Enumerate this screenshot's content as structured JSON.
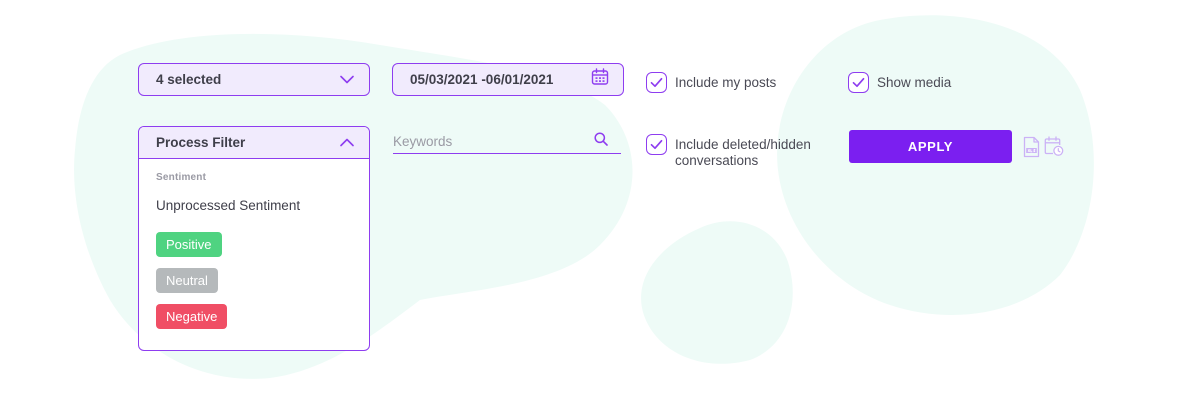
{
  "filters": {
    "selection_summary": "4 selected",
    "date_range": "05/03/2021 -06/01/2021",
    "keywords_placeholder": "Keywords",
    "keywords_value": ""
  },
  "process_filter": {
    "title": "Process Filter",
    "section_label": "Sentiment",
    "option_unprocessed": "Unprocessed Sentiment",
    "chips": [
      {
        "label": "Positive",
        "color": "#4fd381"
      },
      {
        "label": "Neutral",
        "color": "#b5b9bb"
      },
      {
        "label": "Negative",
        "color": "#f04e65"
      }
    ]
  },
  "options": {
    "include_my_posts": {
      "label": "Include my posts",
      "checked": true
    },
    "show_media": {
      "label": "Show media",
      "checked": true
    },
    "include_deleted": {
      "label": "Include deleted/hidden conversations",
      "checked": true
    }
  },
  "actions": {
    "apply_label": "APPLY",
    "icons": [
      "xls-file-icon",
      "calendar-clock-icon"
    ]
  },
  "colors": {
    "accent": "#8e3df0",
    "apply_bg": "#7b1ff0",
    "control_bg": "#f1ebfd",
    "blob": "#eefbf7"
  }
}
